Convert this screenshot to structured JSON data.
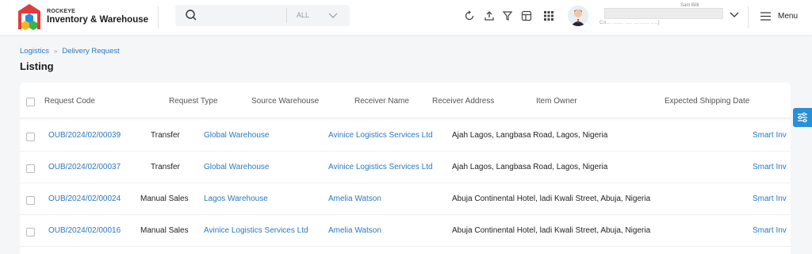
{
  "brand": {
    "small": "ROCKEYE",
    "name": "Inventory & Warehouse"
  },
  "search": {
    "value": "",
    "placeholder": "",
    "filter": "ALL"
  },
  "header_icons": [
    "refresh-icon",
    "upload-icon",
    "filter-icon",
    "layout-icon",
    "apps-grid-icon"
  ],
  "user": {
    "name": "Sam Billi",
    "subtitle": "Co... ...... .... ... ..... ....)"
  },
  "menu_label": "Menu",
  "breadcrumb": {
    "items": [
      "Logistics",
      "Delivery Request"
    ]
  },
  "page_title": "Listing",
  "table": {
    "columns": [
      "Request Code",
      "Request Type",
      "Source Warehouse",
      "Receiver Name",
      "Receiver Address",
      "Item Owner",
      "Expected Shipping Date"
    ],
    "rows": [
      {
        "code": "OUB/2024/02/00039",
        "type": "Transfer",
        "source": "Global Warehouse",
        "receiver": "Avinice Logistics Services Ltd",
        "address": "Ajah Lagos, Langbasa Road, Lagos, Nigeria",
        "owner": "Smart Inv"
      },
      {
        "code": "OUB/2024/02/00037",
        "type": "Transfer",
        "source": "Global Warehouse",
        "receiver": "Avinice Logistics Services Ltd",
        "address": "Ajah Lagos, Langbasa Road, Lagos, Nigeria",
        "owner": "Smart Inv"
      },
      {
        "code": "OUB/2024/02/00024",
        "type": "Manual Sales",
        "source": "Lagos Warehouse",
        "receiver": "Amelia Watson",
        "address": "Abuja Continental Hotel, ladi Kwali Street, Abuja, Nigeria",
        "owner": "Smart Inv"
      },
      {
        "code": "OUB/2024/02/00016",
        "type": "Manual Sales",
        "source": "Avinice Logistics Services Ltd",
        "receiver": "Amelia Watson",
        "address": "Abuja Continental Hotel, ladi Kwali Street, Abuja, Nigeria",
        "owner": "Smart Inv"
      }
    ]
  },
  "colors": {
    "link": "#2b79c2",
    "accent": "#2a8fd8"
  }
}
